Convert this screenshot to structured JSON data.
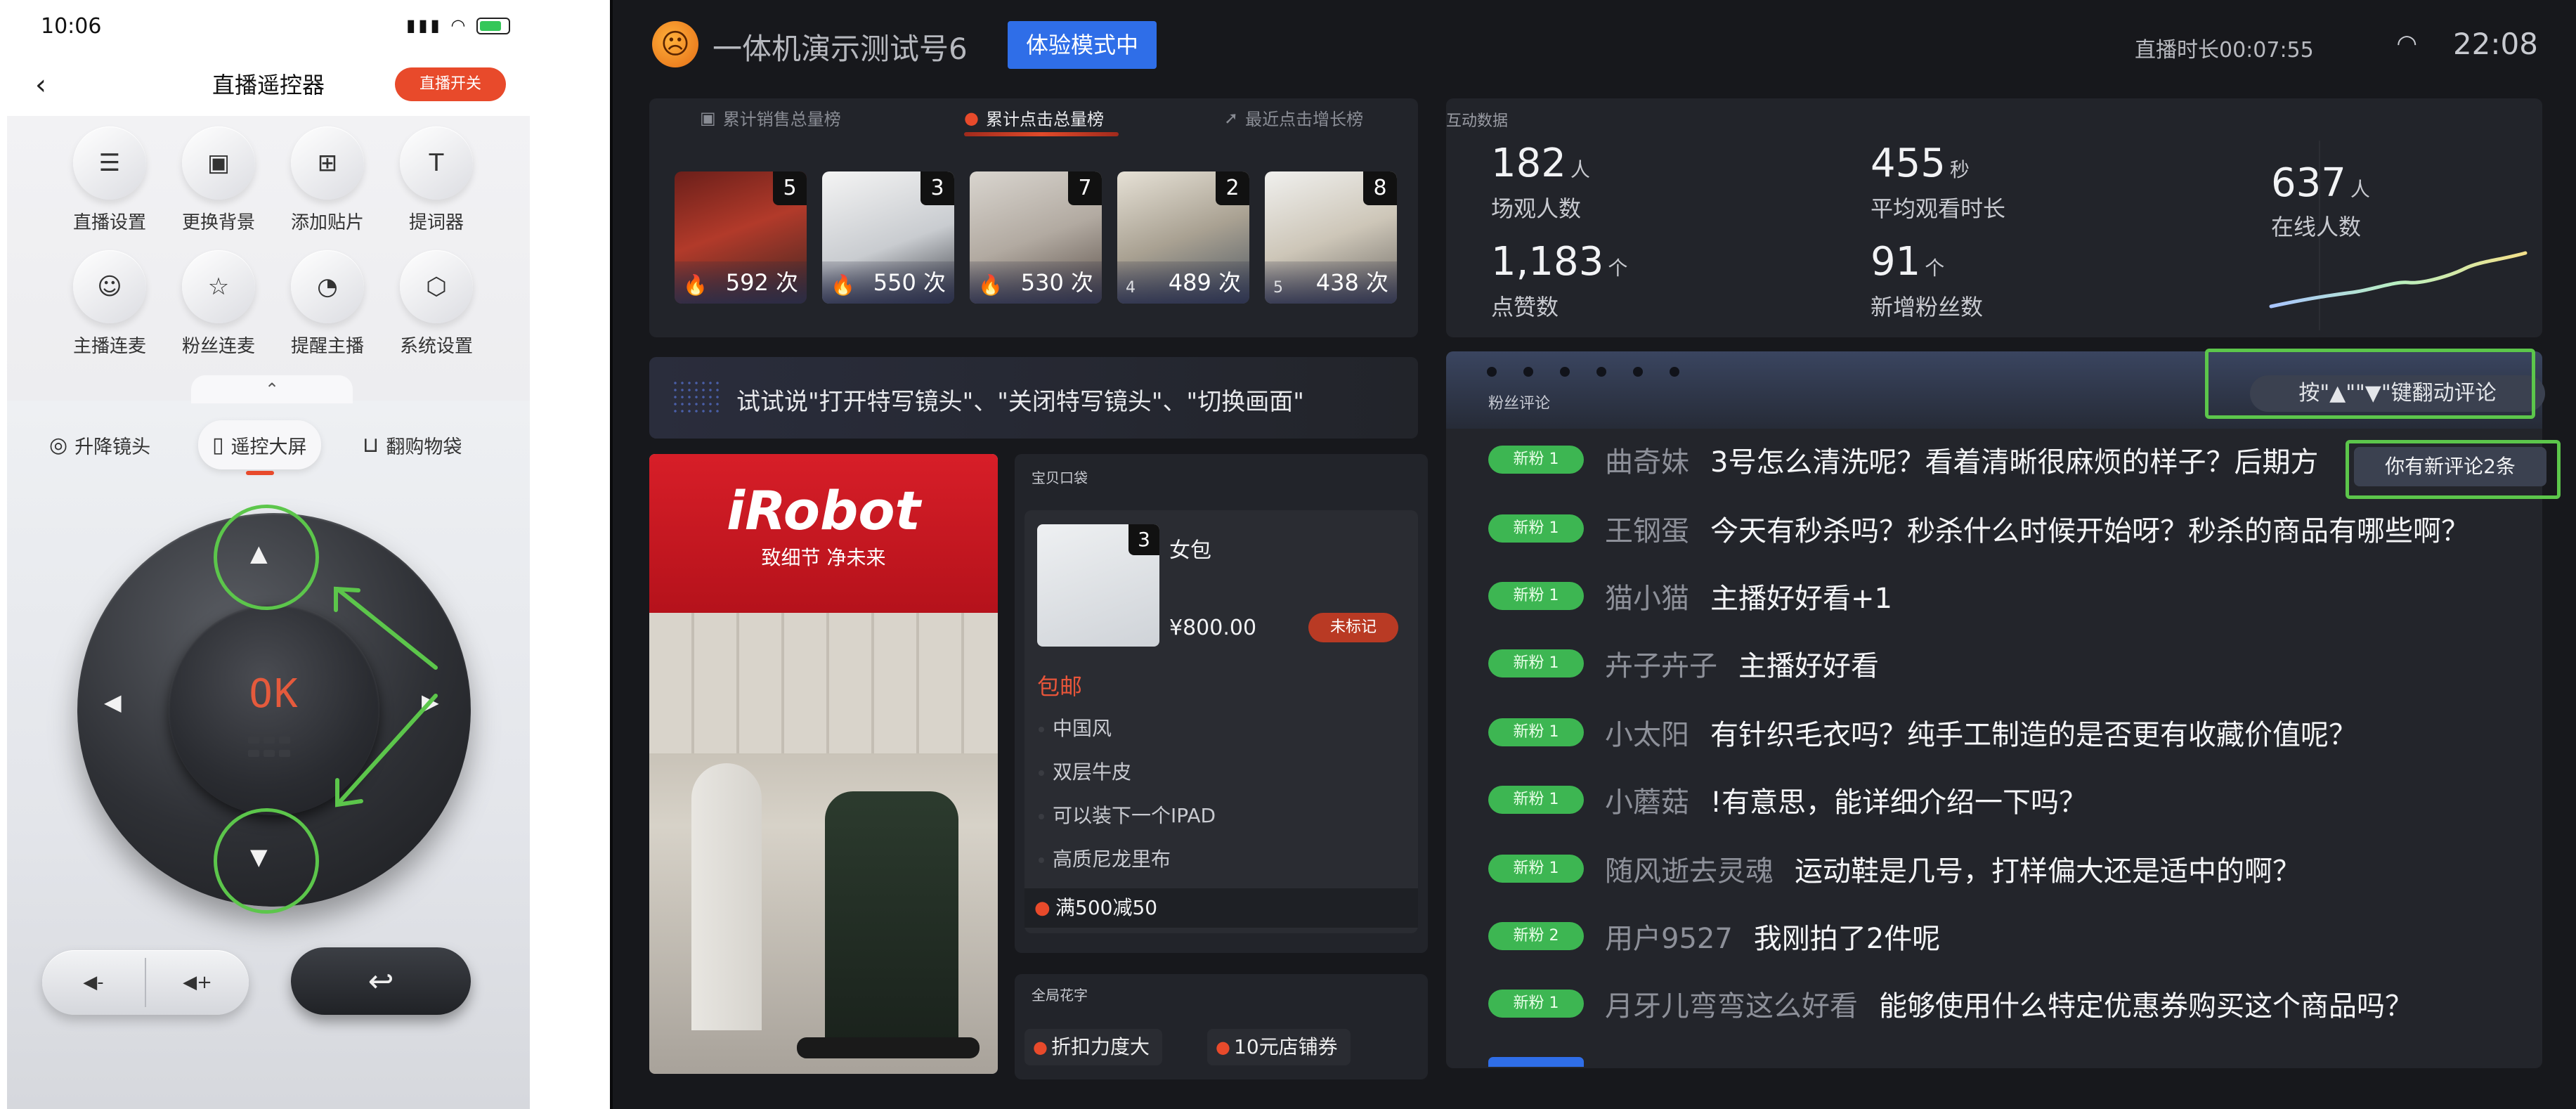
{
  "phone": {
    "status_time": "10:06",
    "title": "直播遥控器",
    "live_switch": "直播开关",
    "grid": [
      {
        "label": "直播设置",
        "icon": "sliders-icon"
      },
      {
        "label": "更换背景",
        "icon": "image-icon"
      },
      {
        "label": "添加贴片",
        "icon": "add-sticker-icon"
      },
      {
        "label": "提词器",
        "icon": "text-icon"
      },
      {
        "label": "主播连麦",
        "icon": "person-mic-icon"
      },
      {
        "label": "粉丝连麦",
        "icon": "fan-star-icon"
      },
      {
        "label": "提醒主播",
        "icon": "bell-icon"
      },
      {
        "label": "系统设置",
        "icon": "hexagon-gear-icon"
      }
    ],
    "mode_tabs": [
      {
        "label": "升降镜头"
      },
      {
        "label": "遥控大屏",
        "active": true
      },
      {
        "label": "翻购物袋"
      }
    ],
    "dpad": {
      "ok": "OK"
    },
    "volume": {
      "down": "◀-",
      "up": "◀+"
    },
    "back_symbol": "↩"
  },
  "screen": {
    "account_name": "一体机演示测试号6",
    "mode_badge": "体验模式中",
    "live_duration": "直播时长00:07:55",
    "clock": "22:08",
    "ranking_tabs": [
      {
        "label": "累计销售总量榜"
      },
      {
        "label": "累计点击总量榜",
        "active": true
      },
      {
        "label": "最近点击增长榜"
      }
    ],
    "ranking_items": [
      {
        "num": "5",
        "rank": "🔥",
        "count": "592 次"
      },
      {
        "num": "3",
        "rank": "🔥",
        "count": "550 次"
      },
      {
        "num": "7",
        "rank": "🔥",
        "count": "530 次"
      },
      {
        "num": "2",
        "rank": "4",
        "count": "489 次"
      },
      {
        "num": "8",
        "rank": "5",
        "count": "438 次"
      }
    ],
    "stats": {
      "title": "互动数据",
      "viewers": {
        "value": "182",
        "unit": "人",
        "label": "场观人数"
      },
      "avg_watch": {
        "value": "455",
        "unit": "秒",
        "label": "平均观看时长"
      },
      "likes": {
        "value": "1,183",
        "unit": "个",
        "label": "点赞数"
      },
      "new_fans": {
        "value": "91",
        "unit": "个",
        "label": "新增粉丝数"
      },
      "online": {
        "value": "637",
        "unit": "人",
        "label": "在线人数"
      }
    },
    "voice_hint": "试试说\"打开特写镜头\"、\"关闭特写镜头\"、\"切换画面\"",
    "video": {
      "logo": "iRobot",
      "slogan": "致细节  净未来"
    },
    "product_section_title": "宝贝口袋",
    "product": {
      "num": "3",
      "name": "女包",
      "price": "¥800.00",
      "mark": "未标记",
      "free_shipping": "包邮",
      "features": [
        "中国风",
        "双层牛皮",
        "可以装下一个IPAD",
        "高质尼龙里布"
      ],
      "promo": "满500减50"
    },
    "global_section_title": "全局花字",
    "global_tags": [
      "折扣力度大",
      "10元店铺券"
    ],
    "comments_title": "粉丝评论",
    "scroll_hint": "按\"▲\"\"▼\"键翻动评论",
    "new_comments": "你有新评论2条",
    "comments": [
      {
        "badge": "新粉 1",
        "user": "曲奇妹",
        "text": "3号怎么清洗呢？看着清晰很麻烦的样子？后期方"
      },
      {
        "badge": "新粉 1",
        "user": "王钢蛋",
        "text": "今天有秒杀吗？秒杀什么时候开始呀？秒杀的商品有哪些啊？"
      },
      {
        "badge": "新粉 1",
        "user": "猫小猫",
        "text": "主播好好看+1"
      },
      {
        "badge": "新粉 1",
        "user": "卉子卉子",
        "text": "主播好好看"
      },
      {
        "badge": "新粉 1",
        "user": "小太阳",
        "text": "有针织毛衣吗？纯手工制造的是否更有收藏价值呢？"
      },
      {
        "badge": "新粉 1",
        "user": "小蘑菇",
        "text": "!有意思，能详细介绍一下吗？"
      },
      {
        "badge": "新粉 1",
        "user": "随风逝去灵魂",
        "text": "运动鞋是几号，打样偏大还是适中的啊？"
      },
      {
        "badge": "新粉 2",
        "user": "用户9527",
        "text": "我刚拍了2件呢"
      },
      {
        "badge": "新粉 1",
        "user": "月牙儿弯弯这么好看",
        "text": "能够使用什么特定优惠券购买这个商品吗？"
      }
    ],
    "colors": {
      "accent_red": "#e84a2b",
      "badge_blue": "#2f6ee8",
      "fan_green": "#3db652",
      "highlight_green": "#5cc64b"
    }
  }
}
